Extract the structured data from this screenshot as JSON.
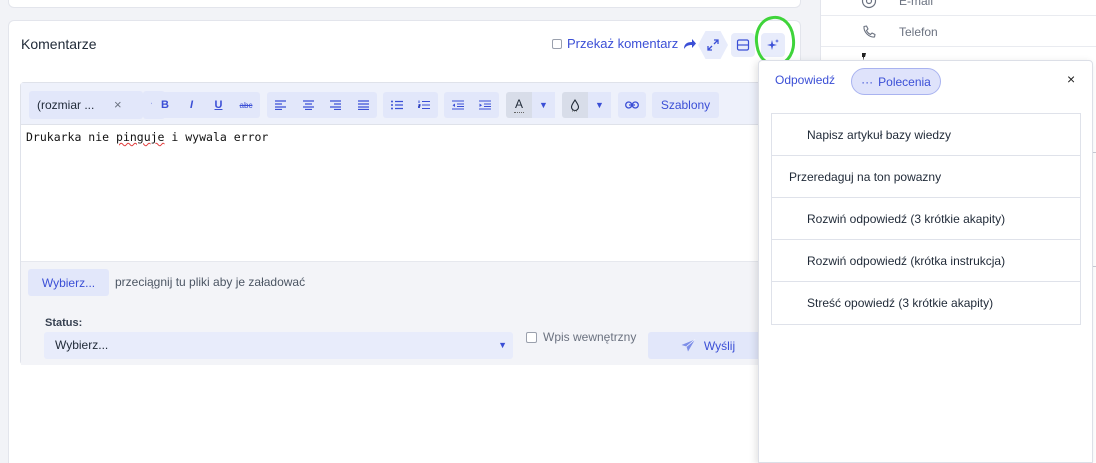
{
  "contact": {
    "email_label": "E-mail",
    "phone_label": "Telefon"
  },
  "comments": {
    "title": "Komentarze",
    "forward_label": "Przekaż komentarz"
  },
  "toolbar": {
    "font_size_value": "(rozmiar ...",
    "clear_symbol": "×",
    "bold": "B",
    "italic": "I",
    "underline": "U",
    "strike": "abc",
    "font_color": "A",
    "templates": "Szablony"
  },
  "editor": {
    "text_before": "Drukarka nie ",
    "misspelled": "pinguje",
    "text_after": " i wywala error"
  },
  "attachments": {
    "choose_label": "Wybierz...",
    "hint": "przeciągnij tu pliki aby je załadować"
  },
  "status": {
    "label": "Status:",
    "value": "Wybierz..."
  },
  "internal_note_label": "Wpis wewnętrzny",
  "send_label": "Wyślij",
  "ai_popup": {
    "tab_reply": "Odpowiedź",
    "tab_commands": "Polecenia",
    "tab_commands_icon": "···",
    "close": "×",
    "commands": [
      {
        "label": "Napisz artykuł bazy wiedzy"
      },
      {
        "label": "Przeredaguj na ton powazny"
      },
      {
        "label": "Rozwiń odpowiedź (3 krótkie akapity)"
      },
      {
        "label": "Rozwiń odpowiedź (krótka instrukcja)"
      },
      {
        "label": "Streść opowiedź (3 krótkie akapity)"
      }
    ]
  },
  "colors": {
    "accent": "#3b4fd6",
    "highlight_circle": "#3fd43a"
  }
}
